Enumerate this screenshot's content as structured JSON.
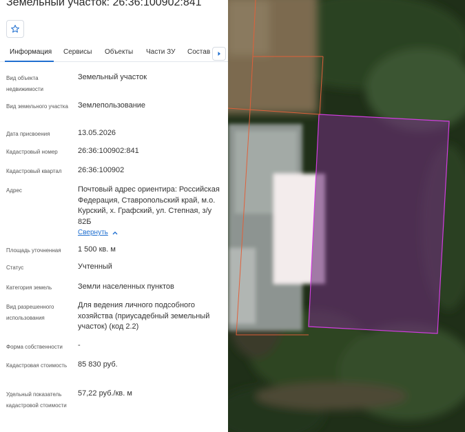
{
  "header": {
    "title": "Земельный участок: 26:36:100902:841"
  },
  "icons": {
    "favorite": "star-outline-icon",
    "tabs_next": "chevron-right-icon",
    "collapse": "chevron-up-icon"
  },
  "colors": {
    "accent": "#1f6fd0",
    "parcel_selected": "#d23ee0",
    "parcel_neighbor": "#e0603a"
  },
  "tabs": [
    {
      "label": "Информация",
      "active": true
    },
    {
      "label": "Сервисы",
      "active": false
    },
    {
      "label": "Объекты",
      "active": false
    },
    {
      "label": "Части ЗУ",
      "active": false
    },
    {
      "label": "Состав",
      "active": false
    }
  ],
  "info": {
    "rows": [
      {
        "label": "Вид объекта недвижимости",
        "value": "Земельный участок"
      },
      {
        "label": "Вид земельного участка",
        "value": "Землепользование"
      },
      {
        "label": "Дата присвоения",
        "value": "13.05.2026"
      },
      {
        "label": "Кадастровый номер",
        "value": "26:36:100902:841"
      },
      {
        "label": "Кадастровый квартал",
        "value": "26:36:100902"
      },
      {
        "label": "Адрес",
        "value": "Почтовый адрес ориентира: Российская Федерация, Ставропольский край, м.о. Курский, х. Графский, ул. Степная, з/у 82Б"
      },
      {
        "label": "Площадь уточненная",
        "value": "1 500 кв. м"
      },
      {
        "label": "Статус",
        "value": "Учтенный"
      },
      {
        "label": "Категория земель",
        "value": "Земли населенных пунктов"
      },
      {
        "label": "Вид разрешенного использования",
        "value": "Для ведения личного подсобного хозяйства (приусадебный земельный участок) (код 2.2)"
      },
      {
        "label": "Форма собственности",
        "value": "-"
      },
      {
        "label": "Кадастровая стоимость",
        "value": "85 830 руб."
      },
      {
        "label": "Удельный показатель кадастровой стоимости",
        "value": "57,22 руб./кв. м"
      }
    ],
    "collapse_label": "Свернуть"
  }
}
